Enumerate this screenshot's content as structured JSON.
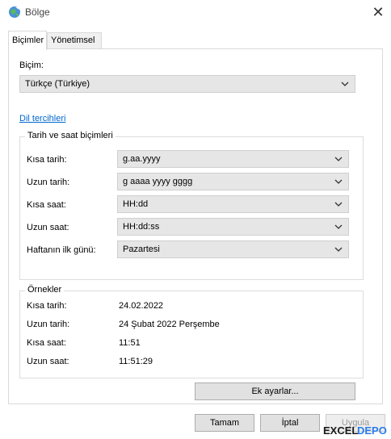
{
  "window": {
    "title": "Bölge",
    "close_glyph": "✕"
  },
  "tabs": [
    {
      "label": "Biçimler",
      "active": true
    },
    {
      "label": "Yönetimsel",
      "active": false
    }
  ],
  "format": {
    "label": "Biçim:",
    "selected": "Türkçe (Türkiye)",
    "language_prefs_link": "Dil tercihleri"
  },
  "datetime_group": {
    "title": "Tarih ve saat biçimleri",
    "rows": [
      {
        "label": "Kısa tarih:",
        "value": "g.aa.yyyy"
      },
      {
        "label": "Uzun tarih:",
        "value": "g aaaa yyyy gggg"
      },
      {
        "label": "Kısa saat:",
        "value": "HH:dd"
      },
      {
        "label": "Uzun saat:",
        "value": "HH:dd:ss"
      },
      {
        "label": "Haftanın ilk günü:",
        "value": "Pazartesi"
      }
    ]
  },
  "examples": {
    "title": "Örnekler",
    "rows": [
      {
        "label": "Kısa tarih:",
        "value": "24.02.2022"
      },
      {
        "label": "Uzun tarih:",
        "value": "24 Şubat 2022 Perşembe"
      },
      {
        "label": "Kısa saat:",
        "value": "11:51"
      },
      {
        "label": "Uzun saat:",
        "value": "11:51:29"
      }
    ]
  },
  "buttons": {
    "more_settings": "Ek ayarlar...",
    "ok": "Tamam",
    "cancel": "İptal",
    "apply": "Uygula"
  },
  "watermark": {
    "part1": "EXCEL",
    "part2": "DEPO"
  },
  "icons": {
    "app": "globe-region-icon",
    "close": "close-icon",
    "dropdown": "chevron-down-icon"
  },
  "colors": {
    "link": "#0066cc",
    "watermark_accent": "#2b7de9"
  }
}
